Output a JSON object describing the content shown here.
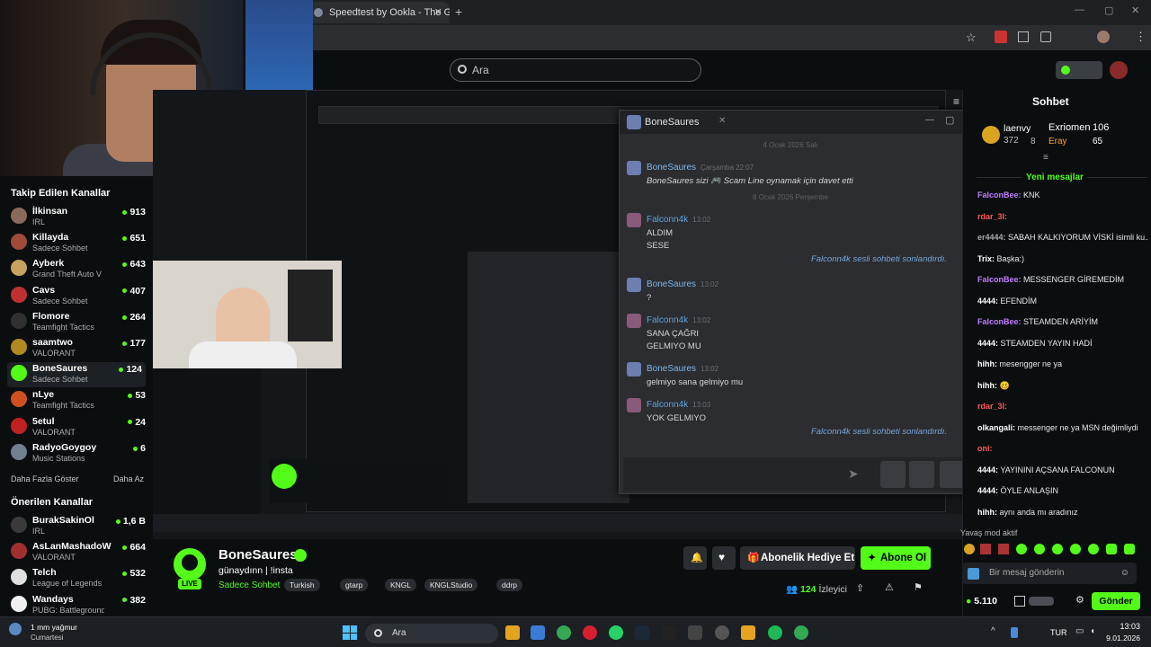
{
  "browser": {
    "tab_title": "Speedtest by Ookla - The Globa",
    "tab_close": "✕",
    "new_tab": "+"
  },
  "site": {
    "search_placeholder": "Ara",
    "brand_color": "#53fc18"
  },
  "sidebar": {
    "followed_title": "Takip Edilen Kanallar",
    "followed": [
      {
        "name": "İlkinsan",
        "game": "IRL",
        "viewers": "913",
        "color": "#8a6a5a"
      },
      {
        "name": "Killayda",
        "game": "Sadece Sohbet",
        "viewers": "651",
        "color": "#a04a3a"
      },
      {
        "name": "Ayberk",
        "game": "Grand Theft Auto V (G...",
        "viewers": "643",
        "color": "#c8a060"
      },
      {
        "name": "Cavs",
        "game": "Sadece Sohbet",
        "viewers": "407",
        "color": "#c03030"
      },
      {
        "name": "Flomore",
        "game": "Teamfight Tactics",
        "viewers": "264",
        "color": "#303030"
      },
      {
        "name": "saamtwo",
        "game": "VALORANT",
        "viewers": "177",
        "color": "#b08a20"
      },
      {
        "name": "BoneSaures",
        "game": "Sadece Sohbet",
        "viewers": "124",
        "color": "#53fc18"
      },
      {
        "name": "nLye",
        "game": "Teamfight Tactics",
        "viewers": "53",
        "color": "#d05020"
      },
      {
        "name": "5etul",
        "game": "VALORANT",
        "viewers": "24",
        "color": "#c02020"
      },
      {
        "name": "RadyoGoygoy",
        "game": "Music Stations",
        "viewers": "6",
        "color": "#708090"
      }
    ],
    "show_more": "Daha Fazla Göster",
    "show_less": "Daha Az",
    "recommended_title": "Önerilen Kanallar",
    "recommended": [
      {
        "name": "BurakSakinOl",
        "game": "IRL",
        "viewers": "1,6 B",
        "color": "#3a3a3a"
      },
      {
        "name": "AsLanMashadoW",
        "game": "VALORANT",
        "viewers": "664",
        "color": "#a03030"
      },
      {
        "name": "Telch",
        "game": "League of Legends",
        "viewers": "532",
        "color": "#e0e0e0"
      },
      {
        "name": "Wandays",
        "game": "PUBG: Battlegrounds",
        "viewers": "382",
        "color": "#f0f0f0"
      }
    ]
  },
  "dialog": {
    "title": "BoneSaures",
    "date1": "4 Ocak 2026 Salı",
    "m1_name": "BoneSaures",
    "m1_time": "Çarşamba 22:07",
    "m1_text": "BoneSaures sizi  🎮 Scam Line oynamak için davet etti",
    "date2": "8 Ocak 2026 Perşembe",
    "m2_name": "Falconn4k",
    "m2_time": "13:02",
    "m2_l1": "ALDIM",
    "m2_l2": "SESE",
    "sys1": "Falconn4k sesli sohbeti sonlandırdı.",
    "m3_name": "BoneSaures",
    "m3_time": "13:02",
    "m3_l1": "?",
    "m4_name": "Falconn4k",
    "m4_time": "13:02",
    "m4_l1": "SANA ÇAĞRI",
    "m4_l2": "GELMIYO MU",
    "m5_name": "BoneSaures",
    "m5_time": "13:02",
    "m5_l1": "gelmiyo sana gelmiyo mu",
    "m6_name": "Falconn4k",
    "m6_time": "13:03",
    "m6_l1": "YOK GELMIYO",
    "sys2": "Falconn4k sesli sohbeti sonlandırdı."
  },
  "stream": {
    "name": "BoneSaures",
    "title": "günaydınn | !insta",
    "category": "Sadece Sohbet",
    "tags": [
      "Turkish",
      "gtarp",
      "KNGL",
      "KNGLStudio",
      "ddrp"
    ],
    "gift_label": "Abonelik Hediye Et",
    "follow_label": "Abone Ol",
    "viewers": "124",
    "viewers_label": "İzleyici",
    "live": "LIVE"
  },
  "chat": {
    "title": "Sohbet",
    "top1_name": "laenvy",
    "top1_val": "372",
    "top2_name": "Exriomen",
    "top2_val": "106",
    "top3_name": "Eray",
    "top3_val": "65",
    "top4_val": "8",
    "new_messages": "Yeni mesajlar",
    "lines": [
      {
        "user": "FalconBee:",
        "text": " KNK",
        "color": "#c17cff"
      },
      {
        "user": "rdar_3I:",
        "text": "",
        "color": "#ff5a5a"
      },
      {
        "user": "er4444:",
        "text": " SABAH KALKIYORUM VİSKİ isimli ku...",
        "color": "#aaaaaa"
      },
      {
        "user": "Trix:",
        "text": " Başka:)",
        "color": "#ffffff"
      },
      {
        "user": "FalconBee:",
        "text": " MESSENGER GİREMEDİM",
        "color": "#c17cff"
      },
      {
        "user": "4444:",
        "text": " EFENDİM",
        "color": "#ffffff"
      },
      {
        "user": "FalconBee:",
        "text": " STEAMDEN ARİYİM",
        "color": "#c17cff"
      },
      {
        "user": "4444:",
        "text": " STEAMDEN YAYIN HADİ",
        "color": "#ffffff"
      },
      {
        "user": "hihh:",
        "text": " mesengger ne ya",
        "color": "#ffffff"
      },
      {
        "user": "hihh:",
        "text": " 🥴",
        "color": "#ffffff"
      },
      {
        "user": "rdar_3I:",
        "text": "",
        "color": "#ff5a5a"
      },
      {
        "user": "olkangali:",
        "text": " messenger ne ya MSN değimliydi",
        "color": "#ffffff"
      },
      {
        "user": "oni:",
        "text": "",
        "color": "#ff5a5a"
      },
      {
        "user": "4444:",
        "text": " YAYININI AÇSANA FALCONUN",
        "color": "#ffffff"
      },
      {
        "user": "4444:",
        "text": " ÖYLE ANLAŞIN",
        "color": "#ffffff"
      },
      {
        "user": "hihh:",
        "text": " aynı anda mı aradınız",
        "color": "#ffffff"
      }
    ],
    "slow_mode": "Yavaş mod aktif",
    "input_placeholder": "Bir mesaj gönderin",
    "points": "5.110",
    "send_label": "Gönder"
  },
  "taskbar": {
    "search_placeholder": "Ara",
    "weather_temp": "1 mm yağmur",
    "weather_day": "Cumartesi",
    "lang": "TUR",
    "time": "13:03",
    "date": "9.01.2026"
  }
}
